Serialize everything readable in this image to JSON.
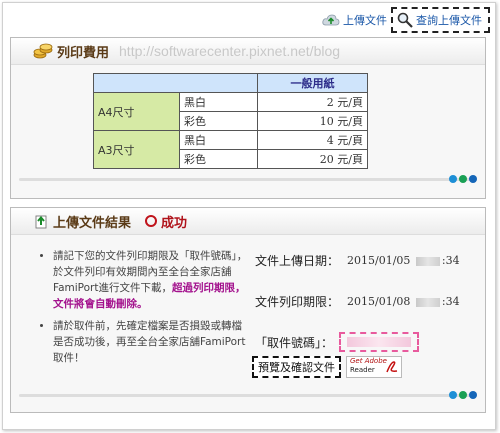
{
  "toplinks": {
    "upload_label": "上傳文件",
    "query_label": "查詢上傳文件"
  },
  "price_panel": {
    "title": "列印費用",
    "watermark": "http://softwarecenter.pixnet.net/blog",
    "table": {
      "header": "一般用紙",
      "rows": [
        {
          "size": "A4尺寸",
          "color": "黑白",
          "price": "2 元/頁"
        },
        {
          "size": "",
          "color": "彩色",
          "price": "10 元/頁"
        },
        {
          "size": "A3尺寸",
          "color": "黑白",
          "price": "4 元/頁"
        },
        {
          "size": "",
          "color": "彩色",
          "price": "20 元/頁"
        }
      ]
    }
  },
  "result_panel": {
    "title": "上傳文件結果",
    "status": "成功",
    "note1_a": "請記下您的文件列印期限及「取件號碼」，於文件列印有效期間內至全台全家店舖FamiPort進行文件下載，",
    "note1_warn": "超過列印期限，文件將會自動刪除。",
    "note2": "請於取件前，先確定檔案是否損毀或轉檔是否成功後，再至全台全家店舖FamiPort取件！",
    "upload_date_label": "文件上傳日期：",
    "upload_date_value_a": "2015/01/05",
    "upload_date_value_b": ":34",
    "print_deadline_label": "文件列印期限：",
    "print_deadline_value_a": "2015/01/08",
    "print_deadline_value_b": ":34",
    "pickup_code_label": "「取件號碼」：",
    "preview_button": "預覽及確認文件",
    "reader_line1": "Get Adobe",
    "reader_line2": "Reader"
  },
  "colors": {
    "dot1": "#1e8fd6",
    "dot2": "#1aa055",
    "dot3": "#1566b8"
  }
}
